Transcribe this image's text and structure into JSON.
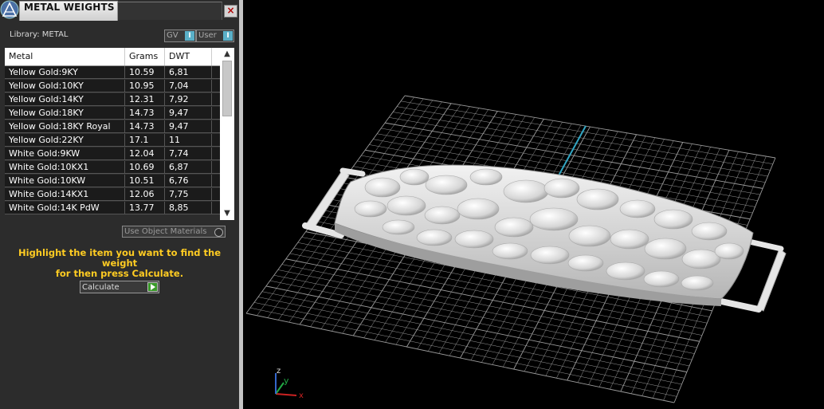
{
  "window": {
    "title": "METAL WEIGHTS",
    "close_label": "×"
  },
  "library": {
    "label": "Library: METAL",
    "gv_label": "GV",
    "user_label": "User",
    "toggle_mark": "I"
  },
  "table": {
    "headers": [
      "Metal",
      "Grams",
      "DWT"
    ],
    "rows": [
      [
        "Yellow Gold:9KY",
        "10.59",
        "6,81"
      ],
      [
        "Yellow Gold:10KY",
        "10.95",
        "7,04"
      ],
      [
        "Yellow Gold:14KY",
        "12.31",
        "7,92"
      ],
      [
        "Yellow Gold:18KY",
        "14.73",
        "9,47"
      ],
      [
        "Yellow Gold:18KY Royal",
        "14.73",
        "9,47"
      ],
      [
        "Yellow Gold:22KY",
        "17.1",
        "11"
      ],
      [
        "White Gold:9KW",
        "12.04",
        "7,74"
      ],
      [
        "White Gold:10KX1",
        "10.69",
        "6,87"
      ],
      [
        "White Gold:10KW",
        "10.51",
        "6,76"
      ],
      [
        "White Gold:14KX1",
        "12.06",
        "7,75"
      ],
      [
        "White Gold:14K PdW",
        "13.77",
        "8,85"
      ]
    ]
  },
  "use_object_materials": {
    "label": "Use Object Materials"
  },
  "hint": {
    "line1": "Highlight the item you want to find the weight",
    "line2": "for then press Calculate."
  },
  "calculate": {
    "label": "Calculate"
  },
  "viewport": {
    "axis_x": "x",
    "axis_y": "y",
    "axis_z": "z"
  },
  "colors": {
    "hint": "#ffcc22",
    "accent": "#5ab0c8",
    "grid": "#9a9a9a",
    "go_button": "#3a9a2a"
  },
  "icons": [
    "app-logo-icon",
    "close-icon",
    "scroll-up-icon",
    "scroll-down-icon",
    "radio-icon",
    "play-arrow-icon",
    "axis-triad-icon"
  ]
}
